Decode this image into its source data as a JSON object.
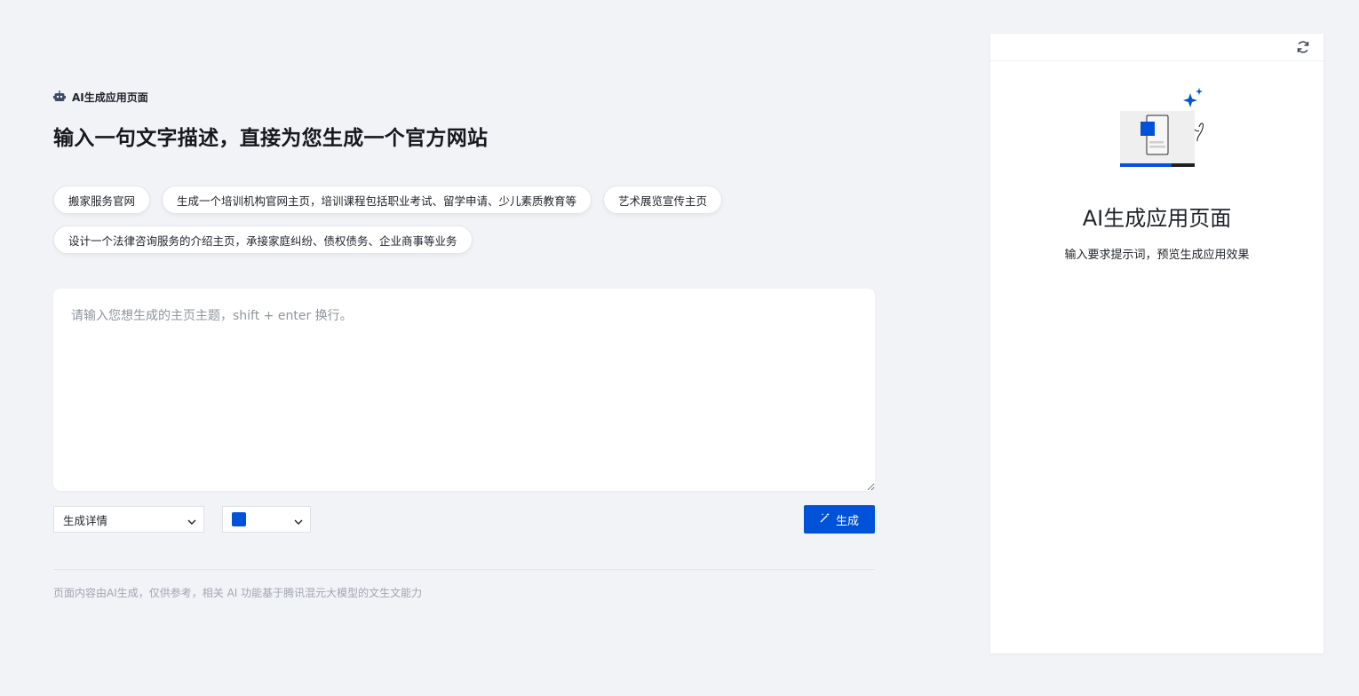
{
  "brand": {
    "label": "AI生成应用页面",
    "icon": "robot-icon"
  },
  "page_title": "输入一句文字描述，直接为您生成一个官方网站",
  "suggestions": [
    "搬家服务官网",
    "生成一个培训机构官网主页，培训课程包括职业考试、留学申请、少儿素质教育等",
    "艺术展览宣传主页",
    "设计一个法律咨询服务的介绍主页，承接家庭纠纷、债权债务、企业商事等业务"
  ],
  "prompt": {
    "placeholder": "请输入您想生成的主页主题，shift + enter 换行。",
    "value": ""
  },
  "controls": {
    "detail_select": "生成详情",
    "color_select": {
      "value": "#0052d9"
    },
    "generate_label": "生成"
  },
  "disclaimer": "页面内容由AI生成，仅供参考，相关 AI 功能基于腾讯混元大模型的文生文能力",
  "preview": {
    "title": "AI生成应用页面",
    "subtitle": "输入要求提示词，预览生成应用效果"
  },
  "colors": {
    "accent": "#0052d9",
    "background": "#f2f3f7"
  }
}
